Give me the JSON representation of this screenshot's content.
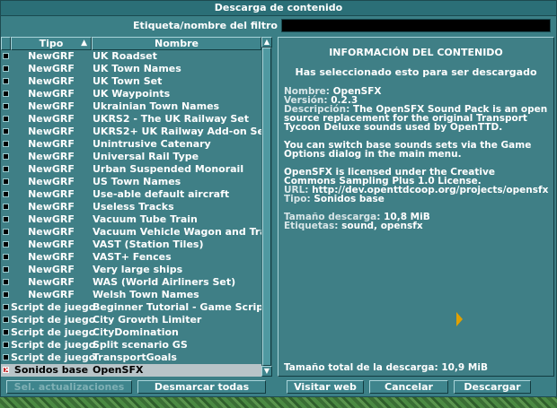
{
  "window": {
    "title": "Descarga de contenido"
  },
  "filter": {
    "label": "Etiqueta/nombre del filtro",
    "value": ""
  },
  "list": {
    "columns": {
      "type": "Tipo",
      "name": "Nombre"
    },
    "sort_icon": "sort-ascending-icon",
    "rows": [
      {
        "type": "NewGRF",
        "name": "UK Roadset",
        "checked": false
      },
      {
        "type": "NewGRF",
        "name": "UK Town Names",
        "checked": false
      },
      {
        "type": "NewGRF",
        "name": "UK Town Set",
        "checked": false
      },
      {
        "type": "NewGRF",
        "name": "UK Waypoints",
        "checked": false
      },
      {
        "type": "NewGRF",
        "name": "Ukrainian Town Names",
        "checked": false
      },
      {
        "type": "NewGRF",
        "name": "UKRS2 - The UK Railway Set",
        "checked": false
      },
      {
        "type": "NewGRF",
        "name": "UKRS2+ UK Railway Add-on Set",
        "checked": false
      },
      {
        "type": "NewGRF",
        "name": "Unintrusive Catenary",
        "checked": false
      },
      {
        "type": "NewGRF",
        "name": "Universal Rail Type",
        "checked": false
      },
      {
        "type": "NewGRF",
        "name": "Urban Suspended Monorail",
        "checked": false
      },
      {
        "type": "NewGRF",
        "name": "US Town Names",
        "checked": false
      },
      {
        "type": "NewGRF",
        "name": "Use-able default aircraft",
        "checked": false
      },
      {
        "type": "NewGRF",
        "name": "Useless Tracks",
        "checked": false
      },
      {
        "type": "NewGRF",
        "name": "Vacuum Tube Train",
        "checked": false
      },
      {
        "type": "NewGRF",
        "name": "Vacuum Vehicle Wagon and Train",
        "checked": false
      },
      {
        "type": "NewGRF",
        "name": "VAST (Station Tiles)",
        "checked": false
      },
      {
        "type": "NewGRF",
        "name": "VAST+ Fences",
        "checked": false
      },
      {
        "type": "NewGRF",
        "name": "Very large ships",
        "checked": false
      },
      {
        "type": "NewGRF",
        "name": "WAS (World Airliners Set)",
        "checked": false
      },
      {
        "type": "NewGRF",
        "name": "Welsh Town Names",
        "checked": false
      },
      {
        "type": "Script de juego",
        "name": "Beginner Tutorial - Game Script",
        "checked": false
      },
      {
        "type": "Script de juego",
        "name": "City Growth Limiter",
        "checked": false
      },
      {
        "type": "Script de juego",
        "name": "CityDomination",
        "checked": false
      },
      {
        "type": "Script de juego",
        "name": "Split scenario GS",
        "checked": false
      },
      {
        "type": "Script de juego",
        "name": "TransportGoals",
        "checked": false
      },
      {
        "type": "Sonidos base",
        "name": "OpenSFX",
        "checked": true,
        "selected": true
      }
    ]
  },
  "scrollbar": {
    "up_icon": "scroll-up-arrow-icon",
    "down_icon": "scroll-down-arrow-icon"
  },
  "info": {
    "title": "INFORMACIÓN DEL CONTENIDO",
    "subtitle": "Has seleccionado esto para ser descargado",
    "name_label": "Nombre:",
    "name": "OpenSFX",
    "version_label": "Versión:",
    "version": "0.2.3",
    "desc_label": "Descripción:",
    "desc1": "The OpenSFX Sound Pack is an open source replacement for the original Transport Tycoon Deluxe sounds used by OpenTTD.",
    "desc2": "You can switch base sounds sets via the Game Options dialog in the main menu.",
    "desc3": "OpenSFX is licensed under the Creative Commons Sampling Plus 1.0 License.",
    "url_label": "URL:",
    "url": "http://dev.openttdcoop.org/projects/opensfx",
    "type_label": "Tipo:",
    "type": "Sonidos base",
    "size_label": "Tamaño descarga:",
    "size": "10,8 MiB",
    "tags_label": "Etiquetas:",
    "tags": "sound, opensfx",
    "total_label": "Tamaño total de la descarga:",
    "total": "10,9 MiB"
  },
  "buttons": {
    "select_updates": "Sel. actualizaciones",
    "unselect_all": "Desmarcar todas",
    "visit_web": "Visitar web",
    "cancel": "Cancelar",
    "download": "Descargar"
  }
}
